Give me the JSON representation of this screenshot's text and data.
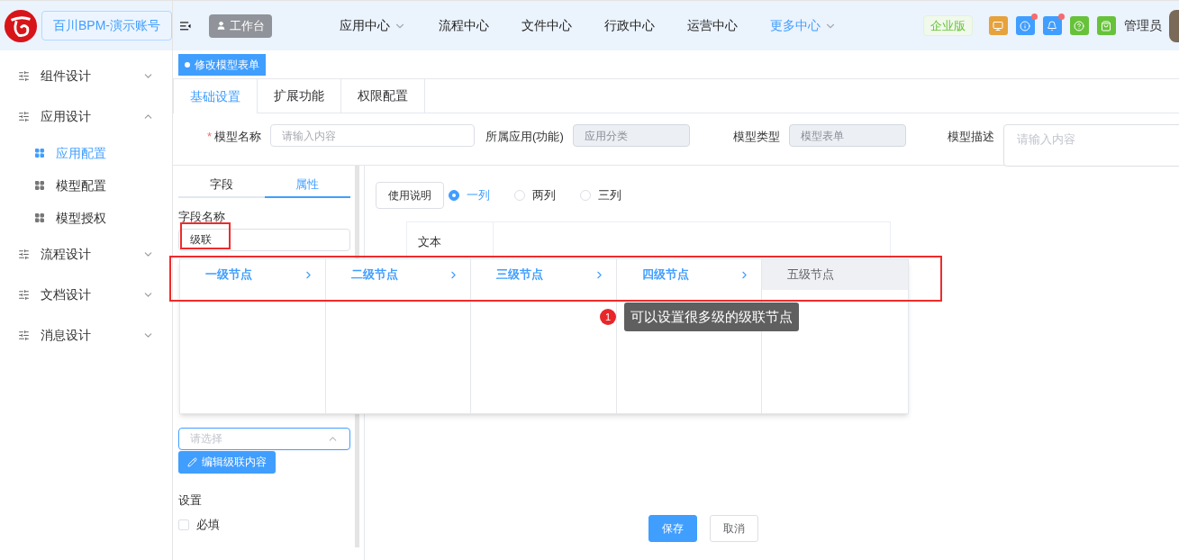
{
  "header": {
    "account": "百川BPM-演示账号",
    "workbench": "工作台",
    "nav": [
      {
        "label": "应用中心",
        "dropdown": true,
        "selected": false
      },
      {
        "label": "流程中心",
        "dropdown": false,
        "selected": false
      },
      {
        "label": "文件中心",
        "dropdown": false,
        "selected": false
      },
      {
        "label": "行政中心",
        "dropdown": false,
        "selected": false
      },
      {
        "label": "运营中心",
        "dropdown": false,
        "selected": false
      },
      {
        "label": "更多中心",
        "dropdown": true,
        "selected": true
      }
    ],
    "edition": "企业版",
    "tools": [
      {
        "kind": "screen",
        "color": "#e6a23c",
        "unread": false
      },
      {
        "kind": "alert",
        "color": "#409eff",
        "unread": true
      },
      {
        "kind": "bell",
        "color": "#409eff",
        "unread": true
      },
      {
        "kind": "help",
        "color": "#67c23a",
        "unread": false
      },
      {
        "kind": "bag",
        "color": "#67c23a",
        "unread": false
      }
    ],
    "user": "管理员"
  },
  "sidebar": [
    {
      "label": "组件设计",
      "expanded": false
    },
    {
      "label": "应用设计",
      "expanded": true,
      "children": [
        {
          "label": "应用配置",
          "selected": true
        },
        {
          "label": "模型配置",
          "selected": false
        },
        {
          "label": "模型授权",
          "selected": false
        }
      ]
    },
    {
      "label": "流程设计",
      "expanded": false
    },
    {
      "label": "文档设计",
      "expanded": false
    },
    {
      "label": "消息设计",
      "expanded": false
    }
  ],
  "page_tag": "修改模型表单",
  "tabs": [
    {
      "label": "基础设置",
      "selected": true
    },
    {
      "label": "扩展功能",
      "selected": false
    },
    {
      "label": "权限配置",
      "selected": false
    }
  ],
  "form": [
    {
      "label": "模型名称",
      "required_mark": "*",
      "placeholder": "请输入内容",
      "disabled": false,
      "kind": "input"
    },
    {
      "label": "所属应用(功能)",
      "placeholder": "应用分类",
      "disabled": true,
      "kind": "input"
    },
    {
      "label": "模型类型",
      "placeholder": "模型表单",
      "disabled": true,
      "kind": "input"
    },
    {
      "label": "模型描述",
      "placeholder": "请输入内容",
      "disabled": false,
      "kind": "textarea"
    }
  ],
  "props_panel": {
    "tabs": [
      {
        "label": "字段",
        "selected": false
      },
      {
        "label": "属性",
        "selected": true
      }
    ],
    "field_name_label": "字段名称",
    "field_name_value": "级联",
    "select_placeholder": "请选择",
    "edit_button": "编辑级联内容",
    "settings_label": "设置",
    "required_option": {
      "label": "必填",
      "checked": false
    }
  },
  "canvas": {
    "help_button": "使用说明",
    "columns_options": [
      {
        "label": "一列",
        "selected": true
      },
      {
        "label": "两列",
        "selected": false
      },
      {
        "label": "三列",
        "selected": false
      }
    ],
    "preview_label": "文本"
  },
  "cascade": [
    {
      "label": "一级节点",
      "active": true,
      "hovered": false,
      "has_children": true
    },
    {
      "label": "二级节点",
      "active": true,
      "hovered": false,
      "has_children": true
    },
    {
      "label": "三级节点",
      "active": true,
      "hovered": false,
      "has_children": true
    },
    {
      "label": "四级节点",
      "active": true,
      "hovered": false,
      "has_children": true
    },
    {
      "label": "五级节点",
      "active": false,
      "hovered": true,
      "has_children": false
    }
  ],
  "annotation": {
    "number": "1",
    "text": "可以设置很多级的级联节点"
  },
  "actions": [
    {
      "label": "保存",
      "primary": true
    },
    {
      "label": "取消",
      "primary": false
    }
  ]
}
